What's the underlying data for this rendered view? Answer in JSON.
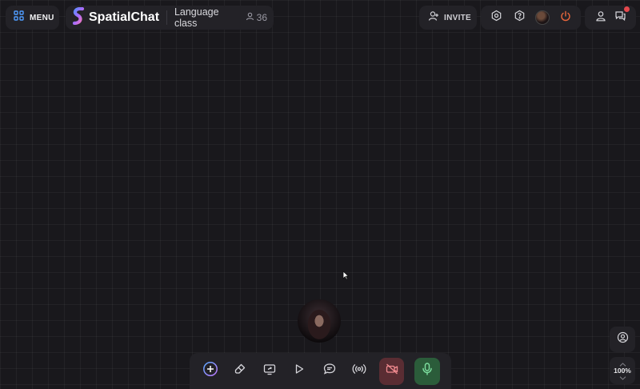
{
  "header": {
    "menu_label": "MENU",
    "app_name": "SpatialChat",
    "room_name": "Language class",
    "participant_count": "36",
    "invite_label": "INVITE"
  },
  "icons": {
    "menu": "grid-icon",
    "logo": "spatialchat-logo-icon",
    "participants": "person-icon",
    "invite": "add-user-icon",
    "settings": "gear-icon",
    "help": "help-icon",
    "leave": "power-icon",
    "profile": "user-icon",
    "chat": "chat-icon"
  },
  "toolbar": {
    "items": [
      "add",
      "draw",
      "share-screen",
      "play-media",
      "chat",
      "broadcast",
      "camera-off",
      "microphone-on"
    ]
  },
  "zoom": {
    "level": "100%"
  },
  "colors": {
    "background": "#19181c",
    "panel": "#232227",
    "accent_blue": "#4f9cff",
    "leave_orange": "#e8663c",
    "camera_off": "#5a2d33",
    "mic_on": "#2b5c3a",
    "notification": "#e5484d"
  }
}
